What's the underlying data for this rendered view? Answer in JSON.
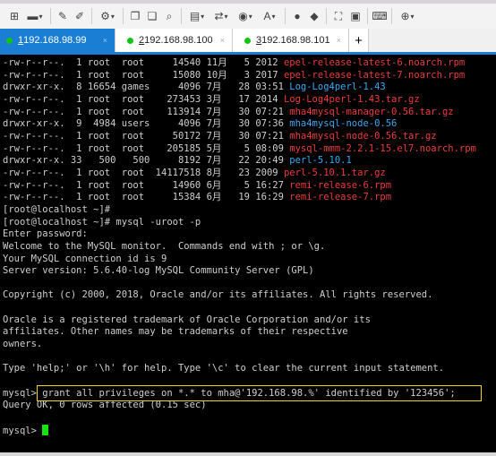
{
  "toolbar": {
    "icons": [
      "new-session-icon",
      "open-folder-icon",
      "connect-icon",
      "disconnect-icon",
      "settings-icon",
      "copy-icon",
      "paste-icon",
      "find-icon",
      "print-icon",
      "transfer-icon",
      "globe-icon",
      "font-icon",
      "xftp-icon",
      "xmanager-icon",
      "fullscreen-icon",
      "lock-icon",
      "keyboard-icon",
      "add-icon"
    ]
  },
  "tabs": [
    {
      "num": "1",
      "label": " 192.168.98.99",
      "close": "×"
    },
    {
      "num": "2",
      "label": " 192.168.98.100",
      "close": "×"
    },
    {
      "num": "3",
      "label": " 192.168.98.101",
      "close": "×"
    }
  ],
  "new_tab": "+",
  "colors": {
    "accent": "#1a7fd4",
    "file": "#ee3b3b",
    "dir": "#3aa8f0",
    "highlight": "#f2d51e",
    "cursor": "#19e019"
  },
  "listing": [
    {
      "meta": "-rw-r--r--.  1 root  root     14540 11月   5 2012 ",
      "name": "epel-release-latest-6.noarch.rpm",
      "type": "r"
    },
    {
      "meta": "-rw-r--r--.  1 root  root     15080 10月   3 2017 ",
      "name": "epel-release-latest-7.noarch.rpm",
      "type": "r"
    },
    {
      "meta": "drwxr-xr-x.  8 16654 games     4096 7月   28 03:51 ",
      "name": "Log-Log4perl-1.43",
      "type": "b"
    },
    {
      "meta": "-rw-r--r--.  1 root  root    273453 3月   17 2014 ",
      "name": "Log-Log4perl-1.43.tar.gz",
      "type": "r"
    },
    {
      "meta": "-rw-r--r--.  1 root  root    113914 7月   30 07:21 ",
      "name": "mha4mysql-manager-0.56.tar.gz",
      "type": "r"
    },
    {
      "meta": "drwxr-xr-x.  9  4984 users     4096 7月   30 07:36 ",
      "name": "mha4mysql-node-0.56",
      "type": "b"
    },
    {
      "meta": "-rw-r--r--.  1 root  root     50172 7月   30 07:21 ",
      "name": "mha4mysql-node-0.56.tar.gz",
      "type": "r"
    },
    {
      "meta": "-rw-r--r--.  1 root  root    205185 5月    5 08:09 ",
      "name": "mysql-mmm-2.2.1-15.el7.noarch.rpm",
      "type": "r"
    },
    {
      "meta": "drwxr-xr-x. 33   500   500     8192 7月   22 20:49 ",
      "name": "perl-5.10.1",
      "type": "b"
    },
    {
      "meta": "-rw-r--r--.  1 root  root  14117518 8月   23 2009 ",
      "name": "perl-5.10.1.tar.gz",
      "type": "r"
    },
    {
      "meta": "-rw-r--r--.  1 root  root     14960 6月    5 16:27 ",
      "name": "remi-release-6.rpm",
      "type": "r"
    },
    {
      "meta": "-rw-r--r--.  1 root  root     15384 6月   19 16:29 ",
      "name": "remi-release-7.rpm",
      "type": "r"
    }
  ],
  "lines": [
    "[root@localhost ~]#",
    "[root@localhost ~]# mysql -uroot -p",
    "Enter password:",
    "Welcome to the MySQL monitor.  Commands end with ; or \\g.",
    "Your MySQL connection id is 9",
    "Server version: 5.6.40-log MySQL Community Server (GPL)",
    "",
    "Copyright (c) 2000, 2018, Oracle and/or its affiliates. All rights reserved.",
    "",
    "Oracle is a registered trademark of Oracle Corporation and/or its",
    "affiliates. Other names may be trademarks of their respective",
    "owners.",
    "",
    "Type 'help;' or '\\h' for help. Type '\\c' to clear the current input statement.",
    ""
  ],
  "grant_line": "mysql> grant all privileges on *.* to mha@'192.168.98.%' identified by '123456';",
  "result_line": "Query OK, 0 rows affected (0.15 sec)",
  "prompt": "mysql> "
}
